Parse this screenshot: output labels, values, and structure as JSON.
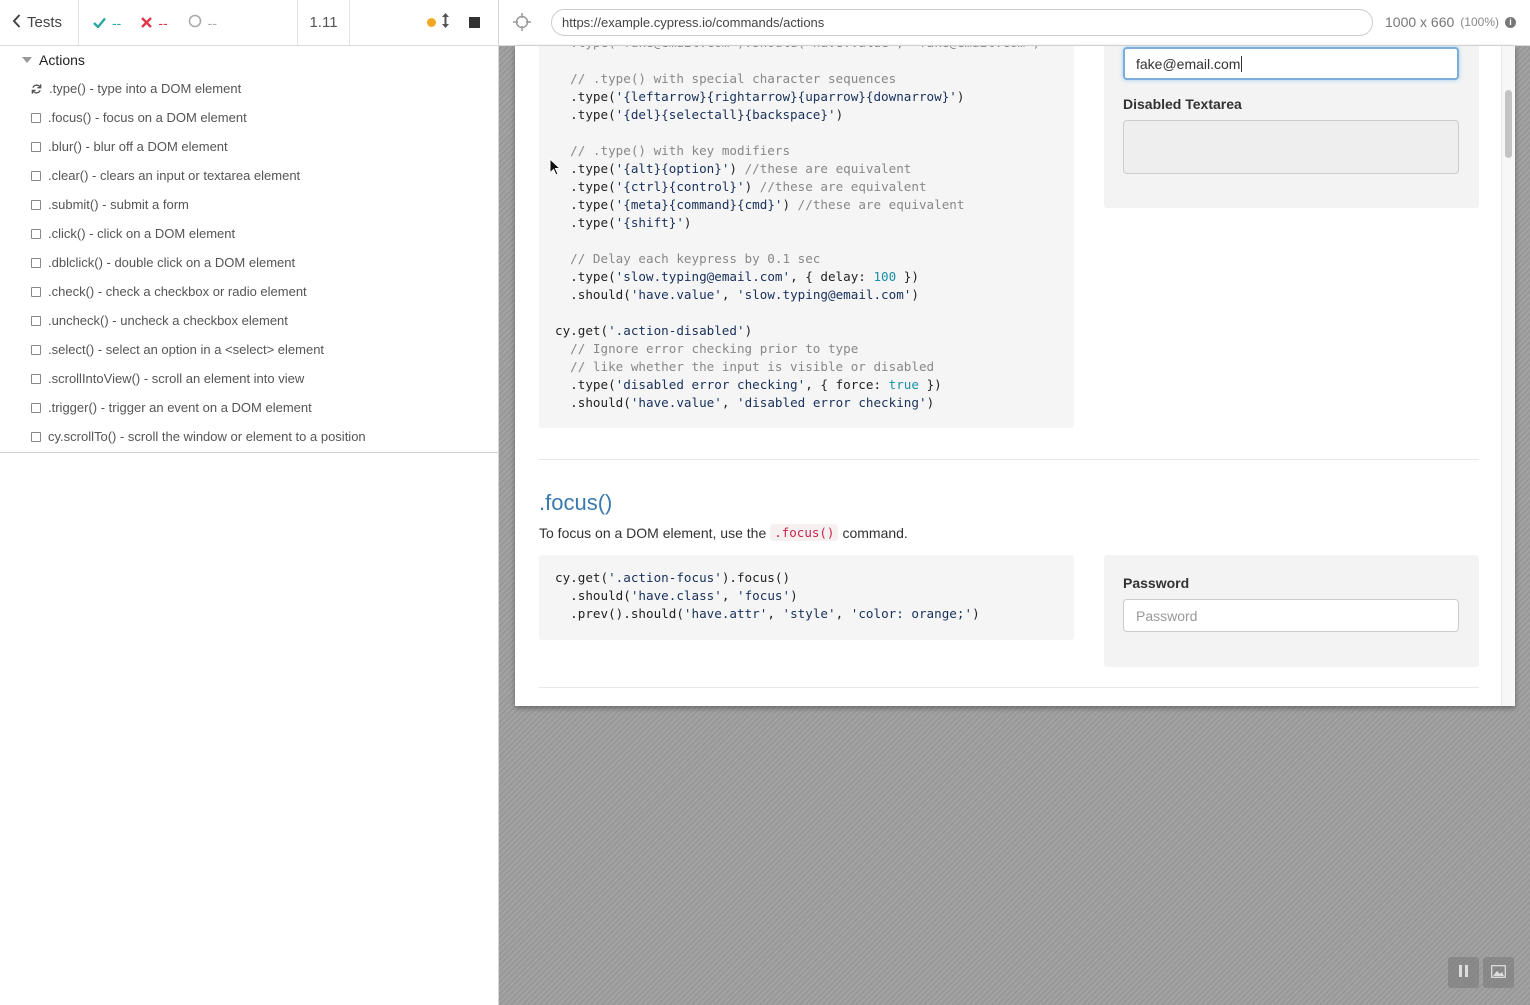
{
  "reporter": {
    "header": {
      "tests_label": "Tests",
      "passed_count": "--",
      "failed_count": "--",
      "pending_count": "--",
      "duration": "1.11"
    },
    "suite": {
      "title": "Actions",
      "tests": [
        {
          "label": ".type() - type into a DOM element",
          "state": "running"
        },
        {
          "label": ".focus() - focus on a DOM element",
          "state": "pending"
        },
        {
          "label": ".blur() - blur off a DOM element",
          "state": "pending"
        },
        {
          "label": ".clear() - clears an input or textarea element",
          "state": "pending"
        },
        {
          "label": ".submit() - submit a form",
          "state": "pending"
        },
        {
          "label": ".click() - click on a DOM element",
          "state": "pending"
        },
        {
          "label": ".dblclick() - double click on a DOM element",
          "state": "pending"
        },
        {
          "label": ".check() - check a checkbox or radio element",
          "state": "pending"
        },
        {
          "label": ".uncheck() - uncheck a checkbox element",
          "state": "pending"
        },
        {
          "label": ".select() - select an option in a <select> element",
          "state": "pending"
        },
        {
          "label": ".scrollIntoView() - scroll an element into view",
          "state": "pending"
        },
        {
          "label": ".trigger() - trigger an event on a DOM element",
          "state": "pending"
        },
        {
          "label": "cy.scrollTo() - scroll the window or element to a position",
          "state": "pending"
        }
      ]
    }
  },
  "runner": {
    "url": "https://example.cypress.io/commands/actions",
    "viewport_size": "1000 x 660",
    "viewport_scale": "(100%)"
  },
  "aut": {
    "type_section": {
      "email_value": "fake@email.com",
      "disabled_textarea_label": "Disabled Textarea"
    },
    "focus_section": {
      "heading": ".focus()",
      "desc_before": "To focus on a DOM element, use the",
      "desc_code": ".focus()",
      "desc_after": "command.",
      "password_label": "Password",
      "password_placeholder": "Password"
    }
  },
  "colors": {
    "accent": "#3a7ab0",
    "passed": "#28a8a0",
    "failed": "#e0394a",
    "running_dot": "#f3a823"
  }
}
